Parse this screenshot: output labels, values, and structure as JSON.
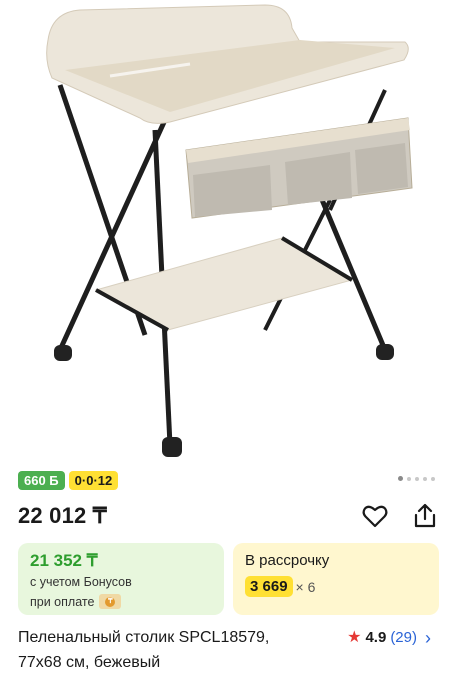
{
  "product": {
    "image_alt": "changing-table-photo",
    "bonus_badge": "660 Б",
    "installment_badge": "0·0·12",
    "price": "22 012 ₸",
    "bonus_card": {
      "price": "21 352 ₸",
      "line1": "с учетом Бонусов",
      "line2": "при оплате"
    },
    "installment_card": {
      "title": "В рассрочку",
      "amount": "3 669",
      "times": "× 6"
    },
    "title_line1": "Пеленальный столик SPCL18579,",
    "title_line2": "77x68 см, бежевый",
    "rating": "4.9",
    "reviews": "(29)"
  },
  "gallery": {
    "total": 5,
    "active_index": 0
  },
  "colors": {
    "bonus_green": "#4caf50",
    "accent_yellow": "#ffe033",
    "link_blue": "#2a63d6",
    "star_red": "#e53935",
    "product_beige": "#ece6da"
  },
  "icons": [
    "heart-icon",
    "share-icon",
    "star-icon",
    "chevron-right-icon",
    "coin-icon"
  ]
}
